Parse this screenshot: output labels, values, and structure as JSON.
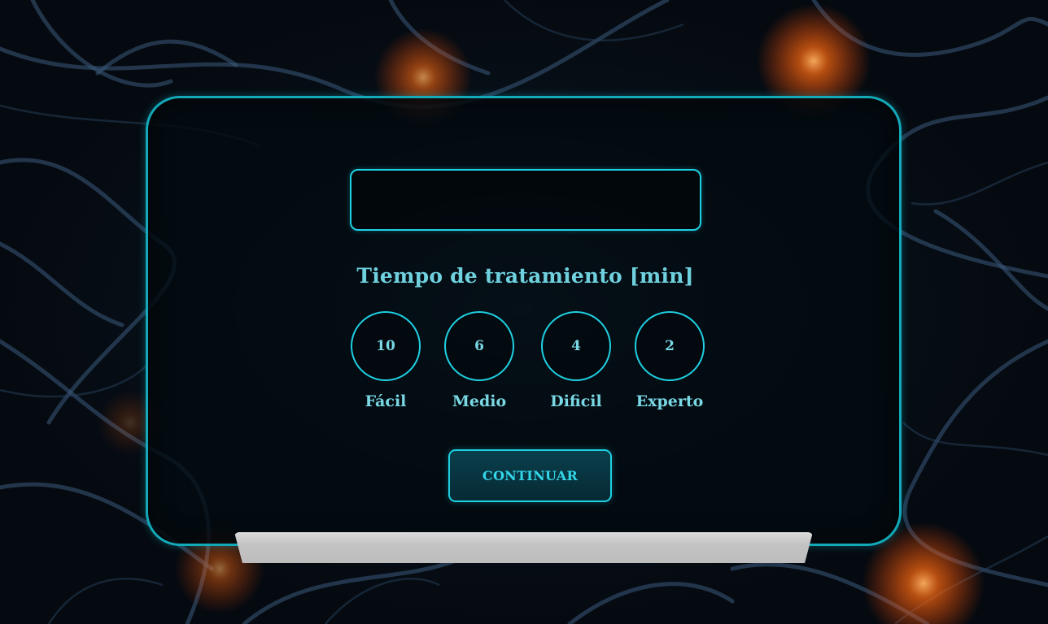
{
  "form": {
    "name_value": "",
    "heading": "Tiempo de tratamiento [min]",
    "options": [
      {
        "minutes": "10",
        "label": "Fácil"
      },
      {
        "minutes": "6",
        "label": "Medio"
      },
      {
        "minutes": "4",
        "label": "Dificil"
      },
      {
        "minutes": "2",
        "label": "Experto"
      }
    ],
    "continue_label": "CONTINUAR"
  },
  "colors": {
    "accent": "#1fd0e2",
    "text": "#79d8e4",
    "background": "#04080d",
    "glow": "#ff7a1a"
  }
}
